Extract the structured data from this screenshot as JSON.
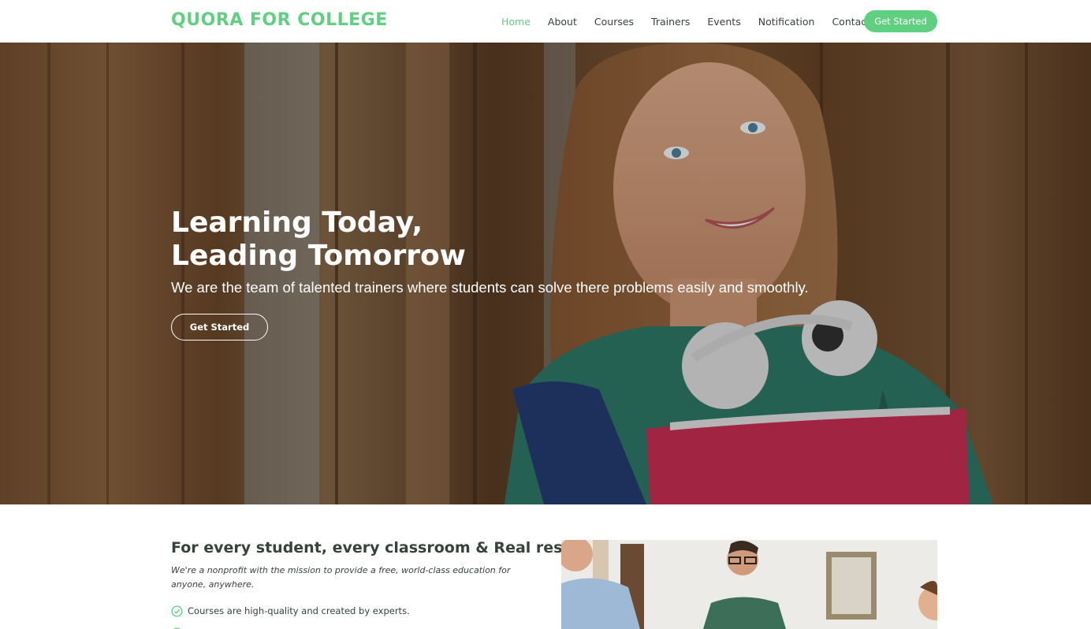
{
  "header": {
    "logo": "QUORA FOR COLLEGE",
    "nav": [
      {
        "label": "Home",
        "active": true
      },
      {
        "label": "About",
        "active": false
      },
      {
        "label": "Courses",
        "active": false
      },
      {
        "label": "Trainers",
        "active": false
      },
      {
        "label": "Events",
        "active": false
      },
      {
        "label": "Notification",
        "active": false
      },
      {
        "label": "Contact",
        "active": false
      }
    ],
    "cta_label": "Get Started"
  },
  "hero": {
    "title_line1": "Learning Today,",
    "title_line2": "Leading Tomorrow",
    "subtitle": "We are the team of talented trainers where students can solve there problems easily and smoothly.",
    "button_label": "Get Started"
  },
  "about": {
    "title": "For every student, every classroom & Real results..",
    "description": "We're a nonprofit with the mission to provide a free, world-class education for anyone, anywhere.",
    "items": [
      {
        "label": "Courses are high-quality and created by experts.",
        "icon": "check-circle-icon"
      },
      {
        "label": "",
        "icon": "check-circle-icon"
      }
    ]
  },
  "colors": {
    "accent": "#5fcf80",
    "text": "#37423b"
  }
}
